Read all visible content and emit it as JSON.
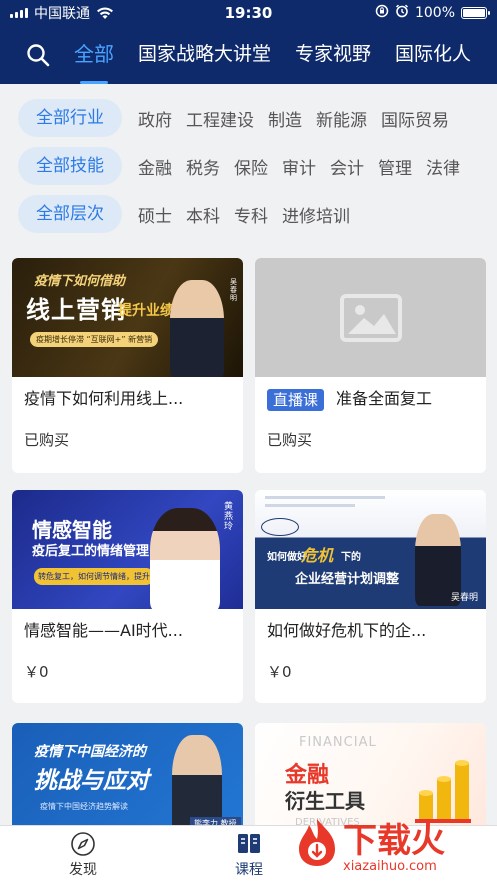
{
  "status_bar": {
    "carrier": "中国联通",
    "time": "19:30",
    "battery": "100%",
    "battery_level": 1.0
  },
  "nav": {
    "tabs": [
      {
        "label": "全部",
        "active": true
      },
      {
        "label": "国家战略大讲堂",
        "active": false
      },
      {
        "label": "专家视野",
        "active": false
      },
      {
        "label": "国际化人",
        "active": false
      }
    ]
  },
  "filters": {
    "industry": {
      "chip": "全部行业",
      "options": [
        "政府",
        "工程建设",
        "制造",
        "新能源",
        "国际贸易"
      ]
    },
    "skill": {
      "chip": "全部技能",
      "options": [
        "金融",
        "税务",
        "保险",
        "审计",
        "会计",
        "管理",
        "法律"
      ]
    },
    "level": {
      "chip": "全部层次",
      "options": [
        "硕士",
        "本科",
        "专科",
        "进修培训"
      ]
    }
  },
  "courses": [
    {
      "title": "疫情下如何利用线上...",
      "footer": "已购买",
      "thumb_text": [
        "疫情下如何借助",
        "线上营销",
        "提升业绩",
        "疫期增长停滞 “互联网+” 新营销",
        "吴春明"
      ]
    },
    {
      "badge": "直播课",
      "title": "准备全面复工",
      "footer": "已购买"
    },
    {
      "title": "情感智能——AI时代...",
      "footer": "￥0",
      "thumb_text": [
        "情感智能",
        "疫后复工的情绪管理",
        "转危复工，如何调节情绪，提升抗压力？",
        "黄 燕 玲"
      ]
    },
    {
      "title": "如何做好危机下的企...",
      "footer": "￥0",
      "thumb_text": [
        "如何做好",
        "危机",
        "下的",
        "企业经营计划调整",
        "吴春明"
      ]
    },
    {
      "title": "",
      "footer": "",
      "thumb_text": [
        "疫情下中国经济的",
        "挑战与应对",
        "疫情下中国经济趋势解读",
        "熊李力 教授"
      ]
    },
    {
      "title": "",
      "footer": "",
      "thumb_text": [
        "FINANCIAL",
        "金融",
        "衍生工具",
        "DERIVATIVES"
      ]
    }
  ],
  "bottom_tabs": [
    {
      "label": "发现",
      "icon": "compass-icon",
      "active": false
    },
    {
      "label": "课程",
      "icon": "book-icon",
      "active": true
    }
  ],
  "watermark": {
    "text": "下载火",
    "url_text": "xiazaihuo.com"
  },
  "colors": {
    "header_bg": "#0e2a6b",
    "accent": "#4aa3ff",
    "chip_bg": "#dde9f6",
    "chip_text": "#2c7be5",
    "live_badge": "#3b6fd8",
    "watermark": "#e8382a"
  }
}
